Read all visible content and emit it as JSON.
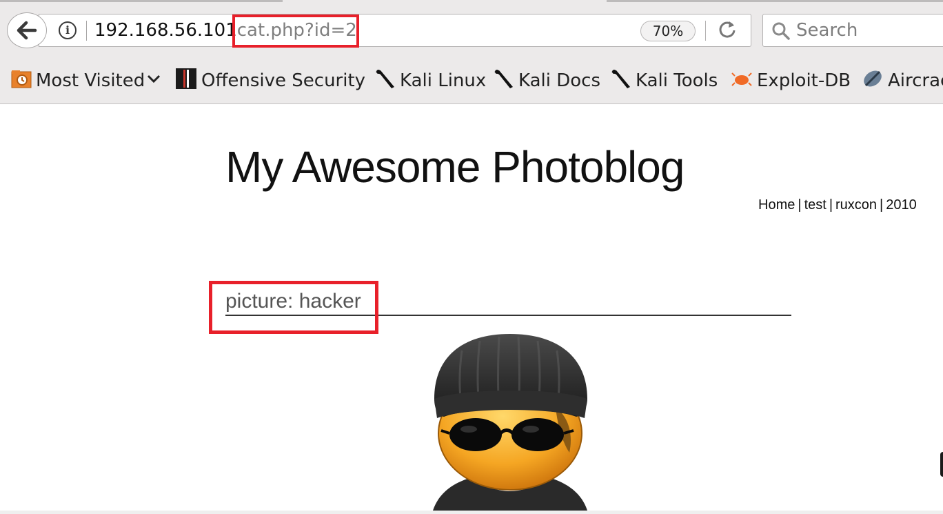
{
  "browser": {
    "url_host": "192.168.56.101",
    "url_path": "cat.php?id=2",
    "zoom": "70%",
    "search_placeholder": "Search"
  },
  "bookmarks": [
    {
      "label": "Most Visited",
      "icon": "folder-clock-icon"
    },
    {
      "label": "Offensive Security",
      "icon": "offsec-icon"
    },
    {
      "label": "Kali Linux",
      "icon": "kali-dragon-icon"
    },
    {
      "label": "Kali Docs",
      "icon": "kali-dragon-icon"
    },
    {
      "label": "Kali Tools",
      "icon": "kali-dragon-icon"
    },
    {
      "label": "Exploit-DB",
      "icon": "exploitdb-bug-icon"
    },
    {
      "label": "Aircrac",
      "icon": "aircrack-icon"
    }
  ],
  "page": {
    "site_title": "My Awesome Photoblog",
    "nav": [
      "Home",
      "test",
      "ruxcon",
      "2010"
    ],
    "post_title": "picture: hacker"
  },
  "colors": {
    "annotation": "#e8202a",
    "chrome_bg": "#eceaea"
  }
}
